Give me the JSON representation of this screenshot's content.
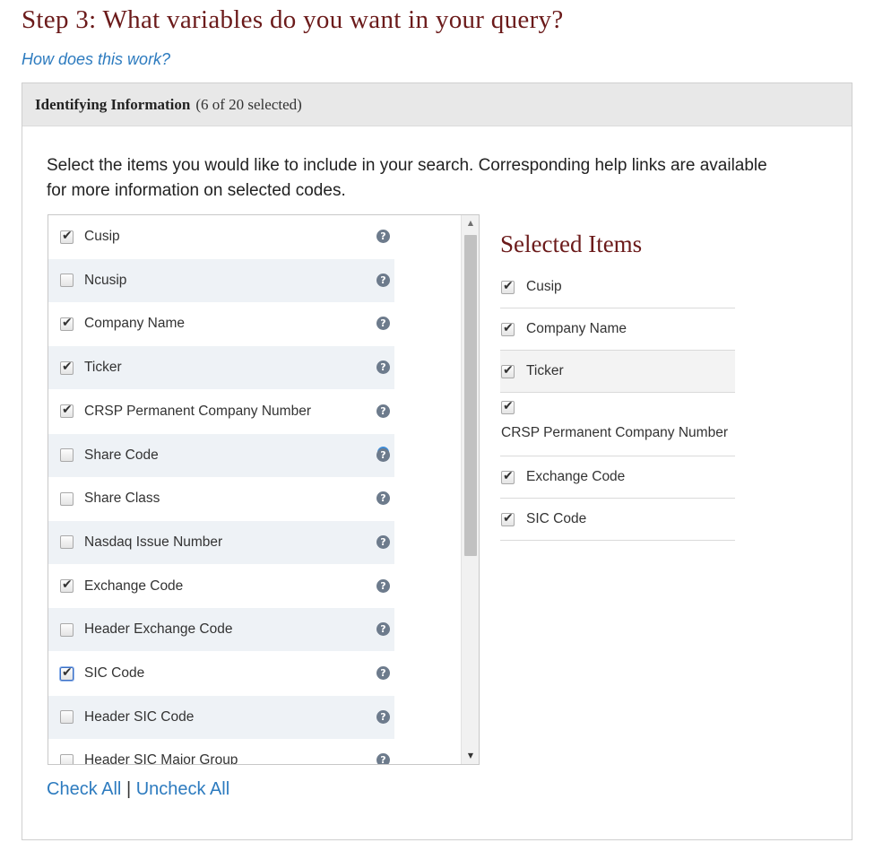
{
  "step_title": "Step 3: What variables do you want in your query?",
  "help_link": "How does this work?",
  "panel": {
    "title": "Identifying Information",
    "count": "(6 of 20 selected)",
    "instructions": "Select the items you would like to include in your search. Corresponding help links are available for more information on selected codes."
  },
  "variables": [
    {
      "label": "Cusip",
      "checked": true
    },
    {
      "label": "Ncusip",
      "checked": false
    },
    {
      "label": "Company Name",
      "checked": true
    },
    {
      "label": "Ticker",
      "checked": true
    },
    {
      "label": "CRSP Permanent Company Number",
      "checked": true
    },
    {
      "label": "Share Code",
      "checked": false
    },
    {
      "label": "Share Class",
      "checked": false
    },
    {
      "label": "Nasdaq Issue Number",
      "checked": false
    },
    {
      "label": "Exchange Code",
      "checked": true
    },
    {
      "label": "Header Exchange Code",
      "checked": false
    },
    {
      "label": "SIC Code",
      "checked": true
    },
    {
      "label": "Header SIC Code",
      "checked": false
    },
    {
      "label": "Header SIC Major Group",
      "checked": false
    }
  ],
  "help_icon_glyph": "?",
  "selected": {
    "title": "Selected Items",
    "items": [
      "Cusip",
      "Company Name",
      "Ticker",
      "CRSP Permanent Company Number",
      "Exchange Code",
      "SIC Code"
    ]
  },
  "links": {
    "check_all": "Check All",
    "separator": "|",
    "uncheck_all": "Uncheck All"
  },
  "scrollbar": {
    "up": "▲",
    "down": "▼"
  },
  "colors": {
    "title": "#6b1a1a",
    "link": "#2d7bbf",
    "row_alt": "#eef2f6"
  }
}
